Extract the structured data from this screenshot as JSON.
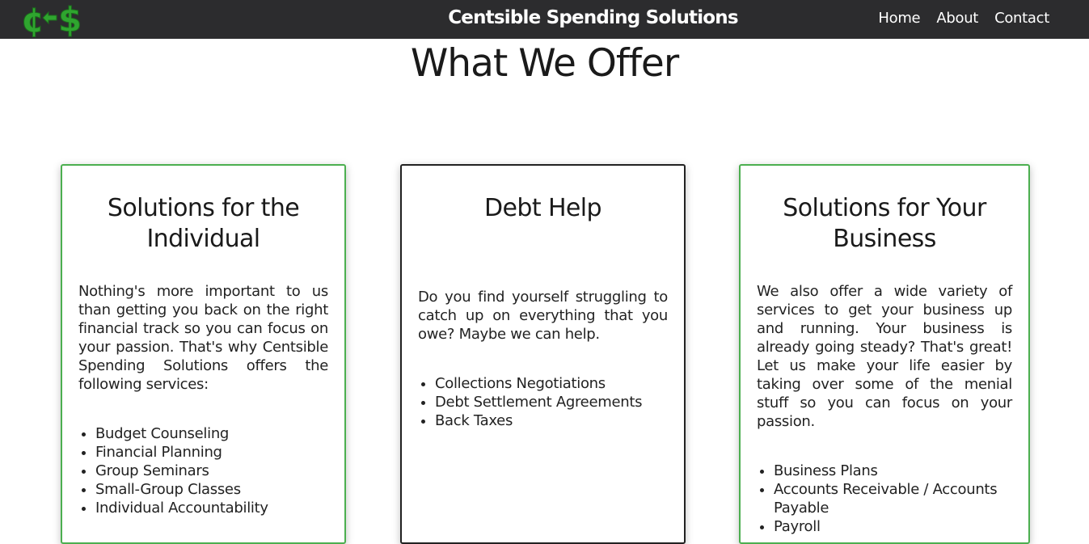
{
  "navbar": {
    "brand": "Centsible Spending Solutions",
    "logo_icon": "cents-dollar-logo-icon",
    "logo_color": "#3bbf3b",
    "links": [
      "Home",
      "About",
      "Contact"
    ]
  },
  "main": {
    "title": "What We Offer"
  },
  "cards": [
    {
      "title": "Solutions for the Individual",
      "text": "Nothing's more important to us than getting you back on the right financial track so you can focus on your passion. That's why Centsible Spending Solutions offers the following services:",
      "items": [
        "Budget Counseling",
        "Financial Planning",
        "Group Seminars",
        "Small-Group Classes",
        "Individual Accountability"
      ],
      "border_color": "#4caf50"
    },
    {
      "title": "Debt Help",
      "text": "Do you find yourself struggling to catch up on everything that you owe? Maybe we can help.",
      "items": [
        "Collections Negotiations",
        "Debt Settlement Agreements",
        "Back Taxes"
      ],
      "border_color": "#222222"
    },
    {
      "title": "Solutions for Your Business",
      "text": "We also offer a wide variety of services to get your business up and running. Your business is already going steady? That's great! Let us make your life easier by taking over some of the menial stuff so you can focus on your passion.",
      "items": [
        "Business Plans",
        "Accounts Receivable / Accounts Payable",
        "Payroll"
      ],
      "border_color": "#4caf50"
    }
  ]
}
